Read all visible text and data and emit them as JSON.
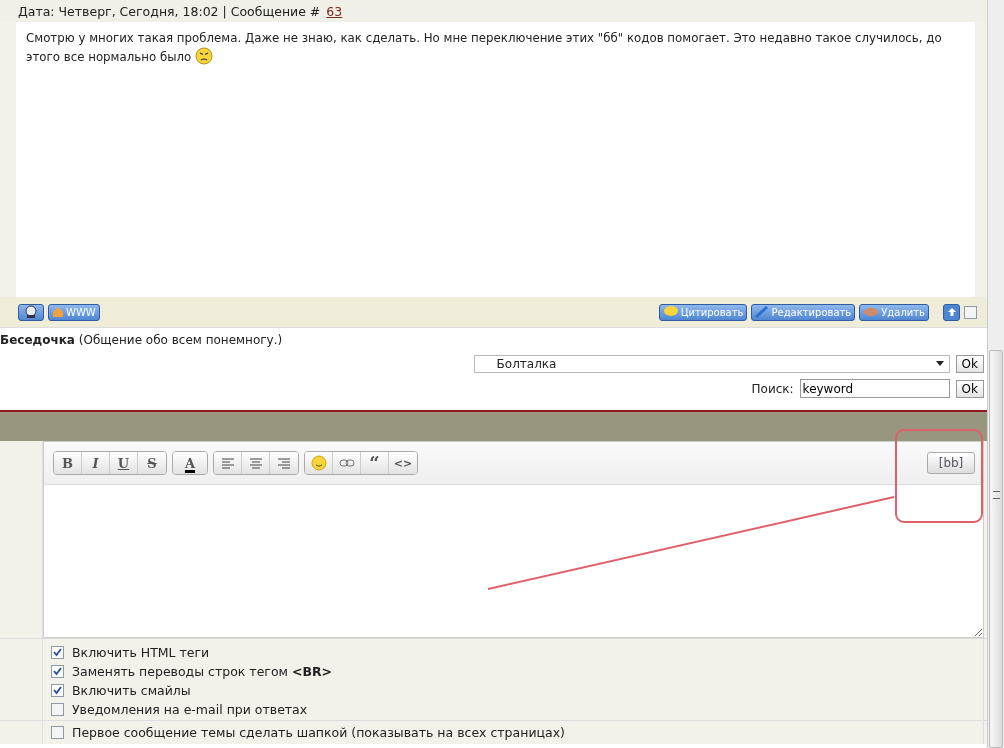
{
  "post": {
    "meta": "Дата: Четверг, Сегодня, 18:02 | Сообщение #",
    "number": "63",
    "body": "Смотрю у многих такая проблема. Даже не знаю, как сделать. Но мне переключение этих \"бб\" кодов помогает. Это недавно такое случилось, до этого все нормально было",
    "left_buttons": [
      {
        "kind": "profile"
      },
      {
        "kind": "www",
        "label": "WWW"
      }
    ],
    "right_buttons": [
      {
        "kind": "quote",
        "label": "Цитировать"
      },
      {
        "kind": "edit",
        "label": "Редактировать"
      },
      {
        "kind": "delete",
        "label": "Удалить"
      }
    ],
    "select_checked": false
  },
  "forum": {
    "title": "**Беседочка** (Общение обо всем понемногу.)",
    "jump_value": "Болталка",
    "jump_button": "Ok",
    "search_label": "Поиск:",
    "search_value": "keyword",
    "search_button": "Ok"
  },
  "editor": {
    "groups": [
      [
        {
          "kind": "bold",
          "label": "B"
        },
        {
          "kind": "italic",
          "label": "I"
        },
        {
          "kind": "underline",
          "label": "U"
        },
        {
          "kind": "strike",
          "label": "S"
        }
      ],
      [
        {
          "kind": "color",
          "label": "A"
        }
      ],
      [
        {
          "kind": "left"
        },
        {
          "kind": "center"
        },
        {
          "kind": "right"
        }
      ],
      [
        {
          "kind": "smile"
        },
        {
          "kind": "link"
        },
        {
          "kind": "quote",
          "label": "“"
        },
        {
          "kind": "code",
          "label": "<>"
        }
      ]
    ],
    "toggle": "[bb]"
  },
  "options": [
    {
      "label": "Включить HTML теги",
      "checked": true
    },
    {
      "label": "Заменять переводы строк тегом **<BR>**",
      "checked": true
    },
    {
      "label": "Включить смайлы",
      "checked": true
    },
    {
      "label": "Уведомления на e-mail при ответах",
      "checked": false
    }
  ],
  "pin_option": {
    "label": "Первое сообщение темы сделать шапкой (показывать на всех страницах)",
    "checked": false
  }
}
